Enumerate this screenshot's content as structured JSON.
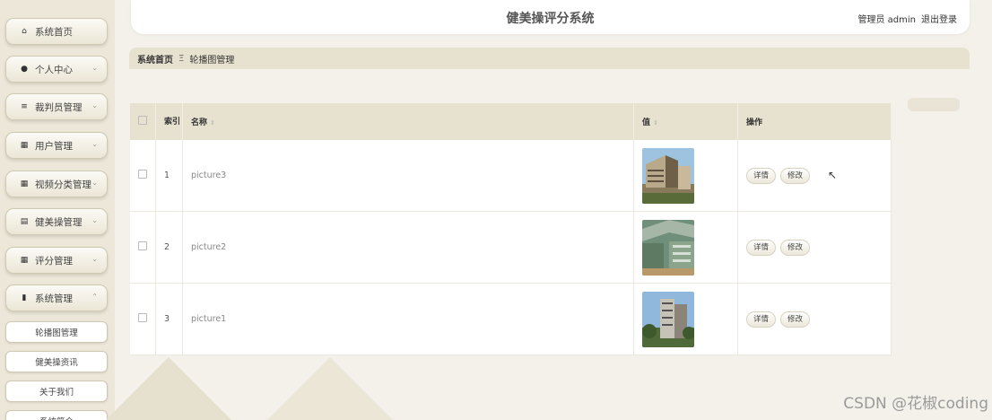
{
  "sidebar": {
    "items": [
      {
        "label": "系统首页",
        "icon": "home-icon",
        "glyph": "⌂"
      },
      {
        "label": "个人中心",
        "icon": "user-icon",
        "glyph": "●",
        "chevron": "⌄"
      },
      {
        "label": "裁判员管理",
        "icon": "list-icon",
        "glyph": "≡",
        "chevron": "⌄"
      },
      {
        "label": "用户管理",
        "icon": "grid-icon",
        "glyph": "▦",
        "chevron": "⌄"
      },
      {
        "label": "视频分类管理",
        "icon": "grid-icon",
        "glyph": "▦",
        "chevron": "⌄"
      },
      {
        "label": "健美操管理",
        "icon": "clipboard-icon",
        "glyph": "▤",
        "chevron": "⌄"
      },
      {
        "label": "评分管理",
        "icon": "grid-icon",
        "glyph": "▦",
        "chevron": "⌄"
      },
      {
        "label": "系统管理",
        "icon": "bar-chart-icon",
        "glyph": "▮",
        "chevron": "⌃"
      }
    ],
    "subitems": [
      {
        "label": "轮播图管理"
      },
      {
        "label": "健美操资讯"
      },
      {
        "label": "关于我们"
      },
      {
        "label": "系统简介"
      }
    ]
  },
  "header": {
    "title": "健美操评分系统",
    "user": "管理员 admin",
    "logout": "退出登录"
  },
  "breadcrumb": {
    "home": "系统首页",
    "separator": "Ξ",
    "current": "轮播图管理"
  },
  "table": {
    "columns": {
      "index": "索引",
      "name": "名称",
      "value": "值",
      "ops": "操作"
    },
    "sort_glyph": "⇕",
    "rows": [
      {
        "index": "1",
        "name": "picture3",
        "image": "building-photo-1"
      },
      {
        "index": "2",
        "name": "picture2",
        "image": "building-photo-2"
      },
      {
        "index": "3",
        "name": "picture1",
        "image": "building-photo-3"
      }
    ],
    "detail_label": "详情",
    "edit_label": "修改"
  },
  "watermark": "CSDN @花椒coding",
  "colors": {
    "accent": "#e7e1cf",
    "background": "#f3f1ea",
    "sidebar": "#ece7d8"
  }
}
